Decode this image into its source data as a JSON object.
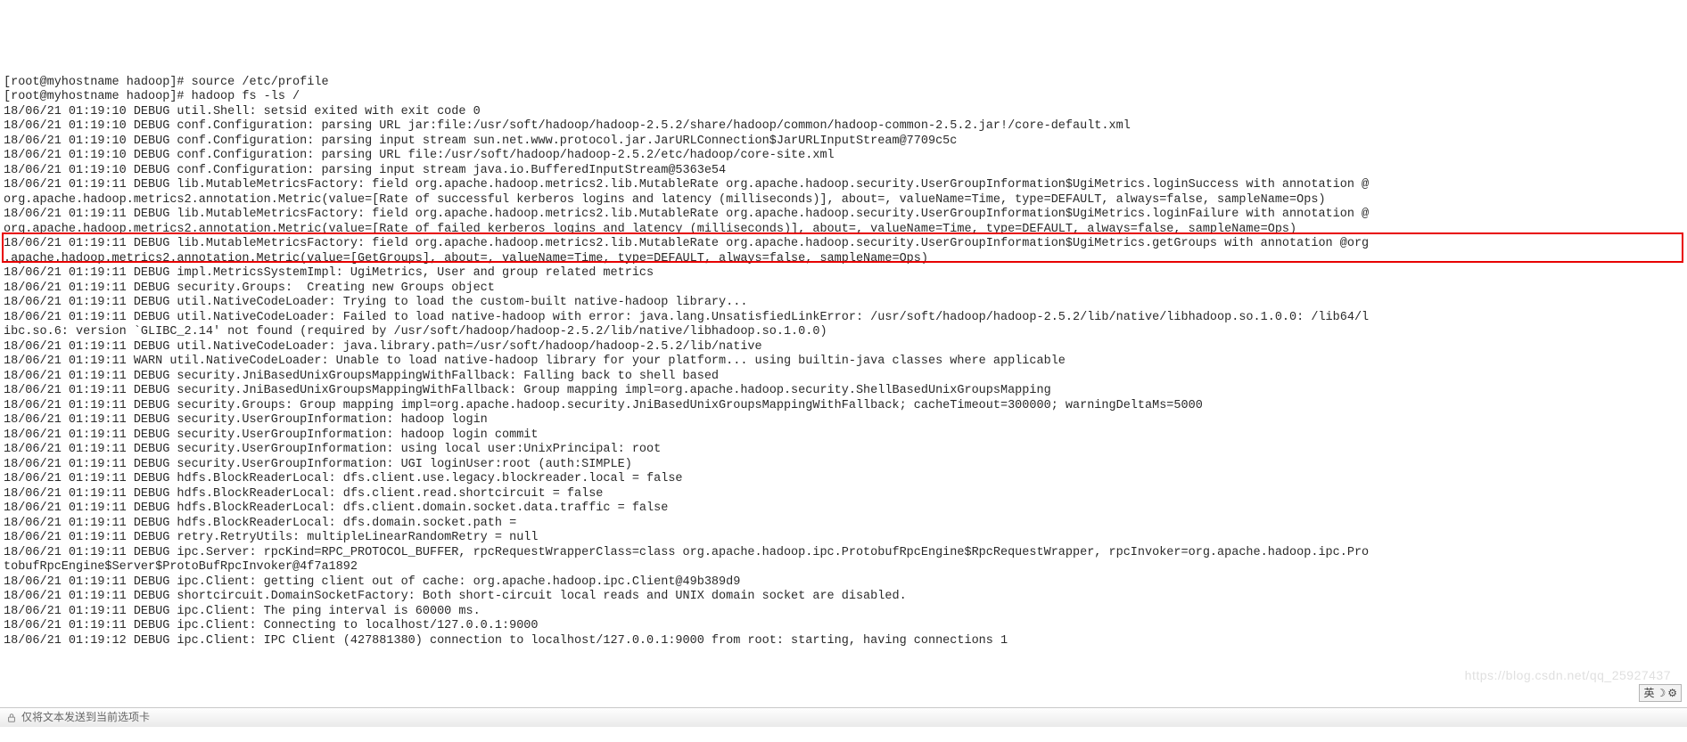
{
  "lines": [
    "[root@myhostname hadoop]# source /etc/profile",
    "[root@myhostname hadoop]# hadoop fs -ls /",
    "18/06/21 01:19:10 DEBUG util.Shell: setsid exited with exit code 0",
    "18/06/21 01:19:10 DEBUG conf.Configuration: parsing URL jar:file:/usr/soft/hadoop/hadoop-2.5.2/share/hadoop/common/hadoop-common-2.5.2.jar!/core-default.xml",
    "18/06/21 01:19:10 DEBUG conf.Configuration: parsing input stream sun.net.www.protocol.jar.JarURLConnection$JarURLInputStream@7709c5c",
    "18/06/21 01:19:10 DEBUG conf.Configuration: parsing URL file:/usr/soft/hadoop/hadoop-2.5.2/etc/hadoop/core-site.xml",
    "18/06/21 01:19:10 DEBUG conf.Configuration: parsing input stream java.io.BufferedInputStream@5363e54",
    "18/06/21 01:19:11 DEBUG lib.MutableMetricsFactory: field org.apache.hadoop.metrics2.lib.MutableRate org.apache.hadoop.security.UserGroupInformation$UgiMetrics.loginSuccess with annotation @",
    "org.apache.hadoop.metrics2.annotation.Metric(value=[Rate of successful kerberos logins and latency (milliseconds)], about=, valueName=Time, type=DEFAULT, always=false, sampleName=Ops)",
    "18/06/21 01:19:11 DEBUG lib.MutableMetricsFactory: field org.apache.hadoop.metrics2.lib.MutableRate org.apache.hadoop.security.UserGroupInformation$UgiMetrics.loginFailure with annotation @",
    "org.apache.hadoop.metrics2.annotation.Metric(value=[Rate of failed kerberos logins and latency (milliseconds)], about=, valueName=Time, type=DEFAULT, always=false, sampleName=Ops)",
    "18/06/21 01:19:11 DEBUG lib.MutableMetricsFactory: field org.apache.hadoop.metrics2.lib.MutableRate org.apache.hadoop.security.UserGroupInformation$UgiMetrics.getGroups with annotation @org",
    ".apache.hadoop.metrics2.annotation.Metric(value=[GetGroups], about=, valueName=Time, type=DEFAULT, always=false, sampleName=Ops)",
    "18/06/21 01:19:11 DEBUG impl.MetricsSystemImpl: UgiMetrics, User and group related metrics",
    "18/06/21 01:19:11 DEBUG security.Groups:  Creating new Groups object",
    "18/06/21 01:19:11 DEBUG util.NativeCodeLoader: Trying to load the custom-built native-hadoop library...",
    "18/06/21 01:19:11 DEBUG util.NativeCodeLoader: Failed to load native-hadoop with error: java.lang.UnsatisfiedLinkError: /usr/soft/hadoop/hadoop-2.5.2/lib/native/libhadoop.so.1.0.0: /lib64/l",
    "ibc.so.6: version `GLIBC_2.14' not found (required by /usr/soft/hadoop/hadoop-2.5.2/lib/native/libhadoop.so.1.0.0)",
    "18/06/21 01:19:11 DEBUG util.NativeCodeLoader: java.library.path=/usr/soft/hadoop/hadoop-2.5.2/lib/native",
    "18/06/21 01:19:11 WARN util.NativeCodeLoader: Unable to load native-hadoop library for your platform... using builtin-java classes where applicable",
    "18/06/21 01:19:11 DEBUG security.JniBasedUnixGroupsMappingWithFallback: Falling back to shell based",
    "18/06/21 01:19:11 DEBUG security.JniBasedUnixGroupsMappingWithFallback: Group mapping impl=org.apache.hadoop.security.ShellBasedUnixGroupsMapping",
    "18/06/21 01:19:11 DEBUG security.Groups: Group mapping impl=org.apache.hadoop.security.JniBasedUnixGroupsMappingWithFallback; cacheTimeout=300000; warningDeltaMs=5000",
    "18/06/21 01:19:11 DEBUG security.UserGroupInformation: hadoop login",
    "18/06/21 01:19:11 DEBUG security.UserGroupInformation: hadoop login commit",
    "18/06/21 01:19:11 DEBUG security.UserGroupInformation: using local user:UnixPrincipal: root",
    "18/06/21 01:19:11 DEBUG security.UserGroupInformation: UGI loginUser:root (auth:SIMPLE)",
    "18/06/21 01:19:11 DEBUG hdfs.BlockReaderLocal: dfs.client.use.legacy.blockreader.local = false",
    "18/06/21 01:19:11 DEBUG hdfs.BlockReaderLocal: dfs.client.read.shortcircuit = false",
    "18/06/21 01:19:11 DEBUG hdfs.BlockReaderLocal: dfs.client.domain.socket.data.traffic = false",
    "18/06/21 01:19:11 DEBUG hdfs.BlockReaderLocal: dfs.domain.socket.path = ",
    "18/06/21 01:19:11 DEBUG retry.RetryUtils: multipleLinearRandomRetry = null",
    "18/06/21 01:19:11 DEBUG ipc.Server: rpcKind=RPC_PROTOCOL_BUFFER, rpcRequestWrapperClass=class org.apache.hadoop.ipc.ProtobufRpcEngine$RpcRequestWrapper, rpcInvoker=org.apache.hadoop.ipc.Pro",
    "tobufRpcEngine$Server$ProtoBufRpcInvoker@4f7a1892",
    "18/06/21 01:19:11 DEBUG ipc.Client: getting client out of cache: org.apache.hadoop.ipc.Client@49b389d9",
    "18/06/21 01:19:11 DEBUG shortcircuit.DomainSocketFactory: Both short-circuit local reads and UNIX domain socket are disabled.",
    "18/06/21 01:19:11 DEBUG ipc.Client: The ping interval is 60000 ms.",
    "18/06/21 01:19:11 DEBUG ipc.Client: Connecting to localhost/127.0.0.1:9000",
    "18/06/21 01:19:12 DEBUG ipc.Client: IPC Client (427881380) connection to localhost/127.0.0.1:9000 from root: starting, having connections 1"
  ],
  "tray": {
    "ime": "英",
    "icon1": "☽",
    "icon2": "⚙"
  },
  "statusbar": {
    "text": "仅将文本发送到当前选项卡"
  },
  "watermark": "https://blog.csdn.net/qq_25927437"
}
